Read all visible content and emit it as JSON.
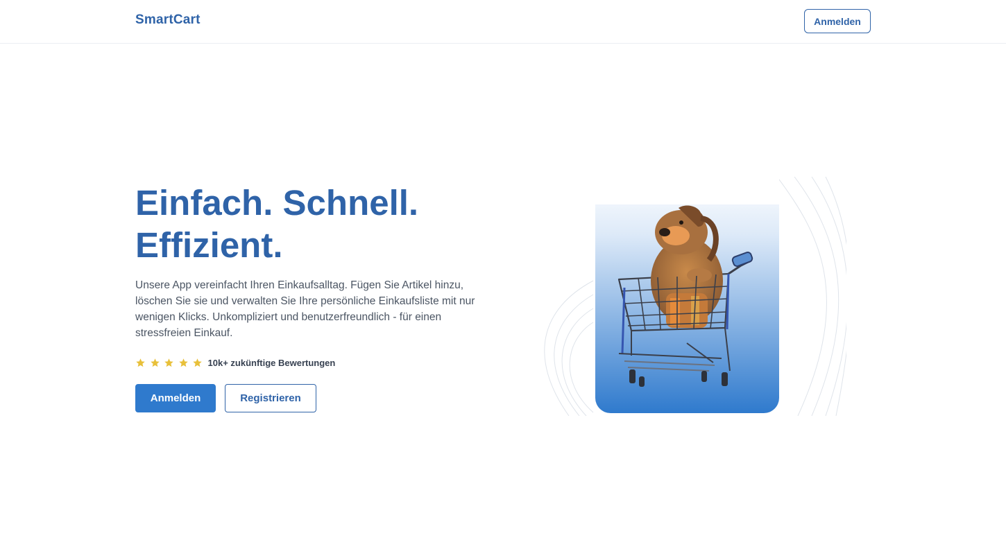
{
  "header": {
    "logo": "SmartCart",
    "login_label": "Anmelden"
  },
  "hero": {
    "title_line1": "Einfach. Schnell.",
    "title_line2": "Effizient.",
    "description": "Unsere App vereinfacht Ihren Einkaufsalltag. Fügen Sie Artikel hinzu, löschen Sie sie und verwalten Sie Ihre persönliche Einkaufsliste mit nur wenigen Klicks. Unkompliziert und benutzerfreundlich - für einen stressfreien Einkauf.",
    "rating": {
      "stars": 5,
      "text": "10k+ zukünftige Bewertungen"
    },
    "primary_button": "Anmelden",
    "secondary_button": "Registrieren"
  },
  "illustration": {
    "subject": "dog-in-shopping-cart"
  },
  "colors": {
    "brand": "#2f63a8",
    "primary_button": "#2f7acd",
    "star": "#e8c03a",
    "text": "#4b5563"
  }
}
